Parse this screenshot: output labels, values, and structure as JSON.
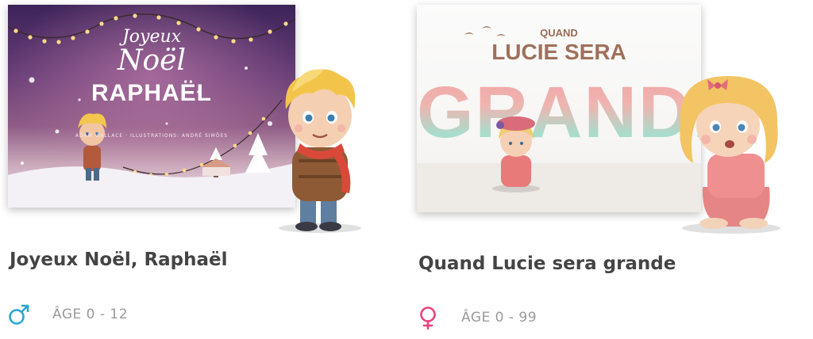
{
  "products": [
    {
      "title": "Joyeux Noël, Raphaël",
      "age": "ÂGE 0 - 12",
      "gender_icon": "male-icon",
      "gender_color": "#2aa6cf",
      "cover": {
        "line1": "Joyeux",
        "line2": "Noël",
        "line3": "RAPHAËL",
        "credits": "ADAM WALLACE · ILLUSTRATIONS: ANDRÉ SIMÕES"
      }
    },
    {
      "title": "Quand Lucie sera grande",
      "age": "ÂGE 0 - 99",
      "gender_icon": "female-icon",
      "gender_color": "#e8427c",
      "cover": {
        "line1": "QUAND",
        "line2": "LUCIE SERA",
        "line3": "GRANDE"
      }
    }
  ]
}
